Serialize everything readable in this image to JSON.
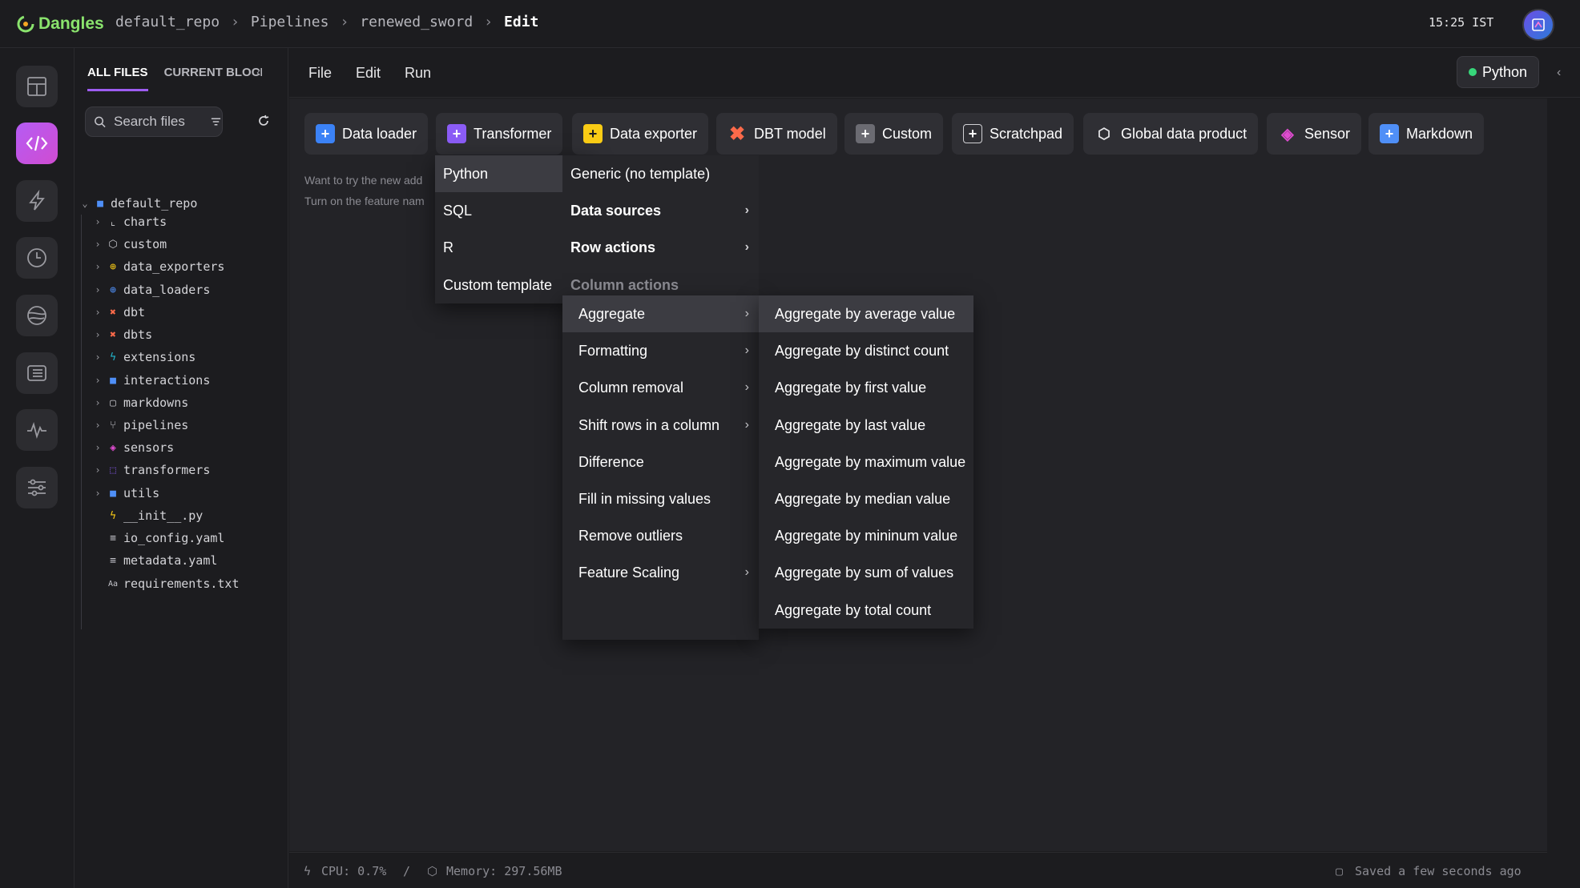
{
  "app": {
    "brand": "Dangles",
    "breadcrumb": [
      "default_repo",
      "Pipelines",
      "renewed_sword"
    ],
    "current_page": "Edit",
    "clock": "15:25 IST"
  },
  "rail": {
    "items": [
      "layout-icon",
      "code-icon",
      "lightning-icon",
      "clock-icon",
      "globe-icon",
      "terminal-icon",
      "activity-icon",
      "sliders-icon"
    ],
    "active_index": 1
  },
  "file_panel": {
    "tabs": [
      "ALL FILES",
      "CURRENT BLOCK"
    ],
    "search_placeholder": "Search files",
    "root": "default_repo",
    "folders": [
      "charts",
      "custom",
      "data_exporters",
      "data_loaders",
      "dbt",
      "dbts",
      "extensions",
      "interactions",
      "markdowns",
      "pipelines",
      "sensors",
      "transformers",
      "utils"
    ],
    "files": [
      "__init__.py",
      "io_config.yaml",
      "metadata.yaml",
      "requirements.txt"
    ]
  },
  "menubar": {
    "items": [
      "File",
      "Edit",
      "Run"
    ],
    "kernel": "Python"
  },
  "blocks": {
    "buttons": [
      "Data loader",
      "Transformer",
      "Data exporter",
      "DBT model",
      "Custom",
      "Scratchpad",
      "Global data product",
      "Sensor",
      "Markdown"
    ],
    "hint_line1": "Want to try the new add",
    "hint_line2": "Turn on the feature nam"
  },
  "menus": {
    "language": [
      "Python",
      "SQL",
      "R",
      "Custom template"
    ],
    "python": [
      "Generic (no template)",
      "Data sources",
      "Row actions",
      "Column actions"
    ],
    "column_actions": [
      "Aggregate",
      "Formatting",
      "Column removal",
      "Shift rows in a column",
      "Difference",
      "Fill in missing values",
      "Remove outliers",
      "Feature Scaling"
    ],
    "aggregate": [
      "Aggregate by average value",
      "Aggregate by distinct count",
      "Aggregate by first value",
      "Aggregate by last value",
      "Aggregate by maximum value",
      "Aggregate by median value",
      "Aggregate by mininum value",
      "Aggregate by sum of values",
      "Aggregate by total count"
    ]
  },
  "status": {
    "cpu": "CPU: 0.7%",
    "divider": "/",
    "memory": "Memory: 297.56MB",
    "saved": "Saved a few seconds ago"
  },
  "colors": {
    "accent": "#9d5cf0",
    "data_loader": "#3b82f6",
    "transformer": "#8b5cf6",
    "data_exporter": "#facc15",
    "dbt": "#fc6a4a",
    "markdown": "#4f8ff7",
    "kernel_status": "#37d67a"
  }
}
